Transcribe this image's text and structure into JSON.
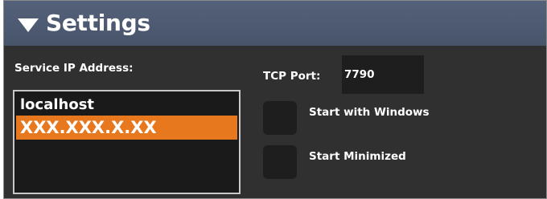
{
  "header": {
    "title": "Settings",
    "expand_icon": "triangle-down-icon"
  },
  "service_ip": {
    "label": "Service IP Address:",
    "items": [
      {
        "label": "localhost",
        "selected": false
      },
      {
        "label": "XXX.XXX.X.XX",
        "selected": true
      }
    ]
  },
  "tcp_port": {
    "label": "TCP Port:",
    "value": "7790"
  },
  "options": {
    "start_with_windows": {
      "label": "Start with Windows",
      "checked": false
    },
    "start_minimized": {
      "label": "Start Minimized",
      "checked": false
    }
  },
  "colors": {
    "panel_bg": "#303030",
    "header_bg": "#4e5a70",
    "selection": "#e8781e",
    "field_bg": "#1e1e1e"
  }
}
